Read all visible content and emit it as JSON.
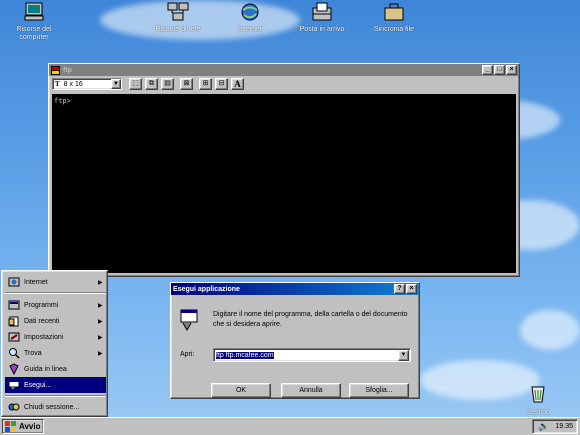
{
  "desktop": {
    "icons": [
      {
        "id": "my-computer",
        "label": "Risorse del computer"
      },
      {
        "id": "network",
        "label": "Risorse di rete"
      },
      {
        "id": "internet",
        "label": "Internet"
      },
      {
        "id": "inbox",
        "label": "Posta in arrivo"
      },
      {
        "id": "briefcase",
        "label": "Sincronia file"
      },
      {
        "id": "recycle-bin",
        "label": "Cestino"
      }
    ]
  },
  "ftp_window": {
    "title": "ftp",
    "font_size": "8 x 16",
    "font_type_label": "T",
    "text_tool_label": "A",
    "console_text": "ftp>"
  },
  "run_dialog": {
    "title": "Esegui applicazione",
    "description": "Digitare il nome del programma, della cartella o del documento che si desidera aprire.",
    "open_label": "Apri:",
    "input_value": "ftp ftp.mcafee.com",
    "ok": "OK",
    "cancel": "Annulla",
    "browse": "Sfoglia...",
    "help_button": "?",
    "close_button": "×"
  },
  "start_menu": {
    "items": [
      {
        "label": "Internet",
        "submenu": true
      },
      {
        "label": "Programmi",
        "submenu": true
      },
      {
        "label": "Dati recenti",
        "submenu": true
      },
      {
        "label": "Impostazioni",
        "submenu": true
      },
      {
        "label": "Trova",
        "submenu": true
      },
      {
        "label": "Guida in linea",
        "submenu": false
      },
      {
        "label": "Esegui...",
        "submenu": false,
        "highlighted": true
      },
      {
        "label": "Chiudi sessione...",
        "submenu": false
      }
    ]
  },
  "taskbar": {
    "start_label": "Avvio",
    "clock": "19.35"
  },
  "colors": {
    "titlebar_active": "#000080",
    "titlebar_inactive": "#808080",
    "face": "#c0c0c0",
    "desktop": "#5a9ee6"
  }
}
